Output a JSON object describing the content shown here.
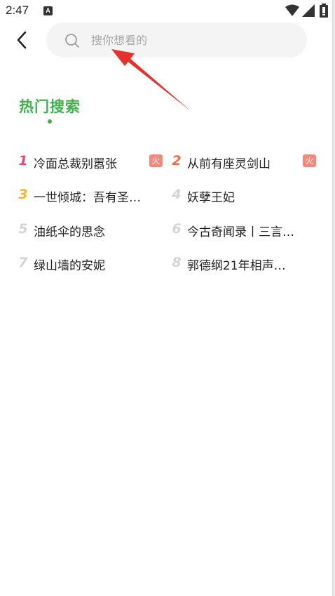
{
  "status_bar": {
    "time": "2:47",
    "badge": "A"
  },
  "header": {
    "back_icon": "chevron-left-icon",
    "search": {
      "icon": "search-icon",
      "placeholder": "搜你想看的",
      "value": ""
    }
  },
  "hot_search": {
    "title": "热门搜索",
    "accent_color": "#3fb24b",
    "tag_color": "#f6877a",
    "items": [
      {
        "rank": "1",
        "label": "冷面总裁别嚣张",
        "tag": "火",
        "rank_color": "#f2456b"
      },
      {
        "rank": "2",
        "label": "从前有座灵剑山",
        "tag": "火",
        "rank_color": "#f36b3f"
      },
      {
        "rank": "3",
        "label": "一世倾城：吾有圣…",
        "tag": "",
        "rank_color": "#f7b52c"
      },
      {
        "rank": "4",
        "label": "妖孽王妃",
        "tag": "",
        "rank_color": "#d4d4d4"
      },
      {
        "rank": "5",
        "label": "油纸伞的思念",
        "tag": "",
        "rank_color": "#d4d4d4"
      },
      {
        "rank": "6",
        "label": "今古奇闻录丨三言…",
        "tag": "",
        "rank_color": "#d4d4d4"
      },
      {
        "rank": "7",
        "label": "绿山墙的安妮",
        "tag": "",
        "rank_color": "#d4d4d4"
      },
      {
        "rank": "8",
        "label": "郭德纲21年相声…",
        "tag": "",
        "rank_color": "#d4d4d4"
      }
    ]
  },
  "annotation": {
    "arrow_color": "#e8302a"
  }
}
